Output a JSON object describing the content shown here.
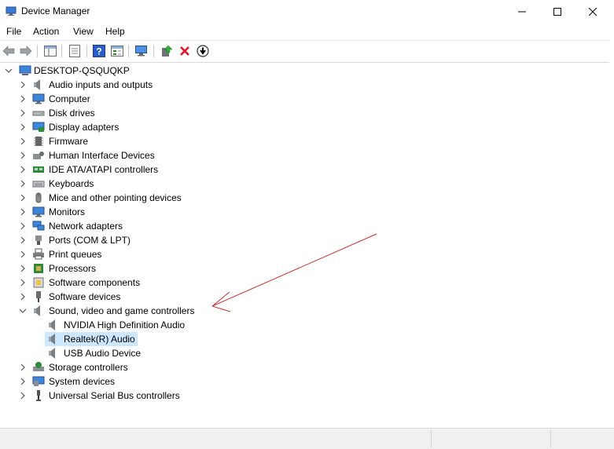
{
  "window": {
    "title": "Device Manager"
  },
  "menu": [
    "File",
    "Action",
    "View",
    "Help"
  ],
  "toolbar": {
    "icons": [
      "back-arrow-icon",
      "forward-arrow-icon",
      "show-hide-tree-icon",
      "properties-icon",
      "help-icon",
      "view-icon",
      "scan-hardware-icon",
      "update-driver-icon",
      "uninstall-x-icon",
      "download-icon"
    ]
  },
  "tree": {
    "root": "DESKTOP-QSQUQKP",
    "categories": [
      {
        "label": "Audio inputs and outputs",
        "icon": "speaker-icon"
      },
      {
        "label": "Computer",
        "icon": "monitor-icon"
      },
      {
        "label": "Disk drives",
        "icon": "disk-drive-icon"
      },
      {
        "label": "Display adapters",
        "icon": "display-adapter-icon"
      },
      {
        "label": "Firmware",
        "icon": "firmware-chip-icon"
      },
      {
        "label": "Human Interface Devices",
        "icon": "hid-icon"
      },
      {
        "label": "IDE ATA/ATAPI controllers",
        "icon": "ide-controller-icon"
      },
      {
        "label": "Keyboards",
        "icon": "keyboard-icon"
      },
      {
        "label": "Mice and other pointing devices",
        "icon": "mouse-icon"
      },
      {
        "label": "Monitors",
        "icon": "monitor-icon"
      },
      {
        "label": "Network adapters",
        "icon": "network-adapter-icon"
      },
      {
        "label": "Ports (COM & LPT)",
        "icon": "port-icon"
      },
      {
        "label": "Print queues",
        "icon": "printer-icon"
      },
      {
        "label": "Processors",
        "icon": "processor-icon"
      },
      {
        "label": "Software components",
        "icon": "software-component-icon"
      },
      {
        "label": "Software devices",
        "icon": "software-device-icon"
      },
      {
        "label": "Sound, video and game controllers",
        "icon": "speaker-icon"
      }
    ],
    "sound_children": [
      {
        "label": "NVIDIA High Definition Audio",
        "selected": false
      },
      {
        "label": "Realtek(R) Audio",
        "selected": true
      },
      {
        "label": "USB Audio Device",
        "selected": false
      }
    ],
    "after_categories": [
      {
        "label": "Storage controllers",
        "icon": "storage-controller-icon"
      },
      {
        "label": "System devices",
        "icon": "system-device-icon"
      },
      {
        "label": "Universal Serial Bus controllers",
        "icon": "usb-icon"
      }
    ]
  },
  "colors": {
    "selection": "#cce8ff",
    "annotation_arrow": "#d03030",
    "uninstall_red": "#e81123"
  }
}
